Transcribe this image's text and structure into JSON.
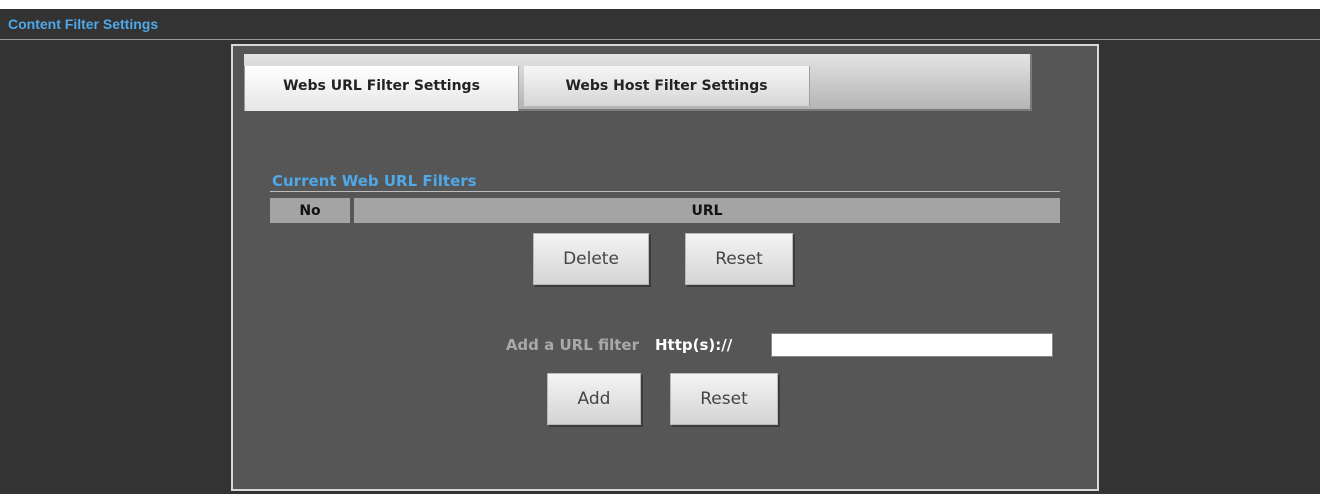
{
  "header": {
    "title": "Content Filter Settings"
  },
  "tabs": [
    {
      "label": "Webs URL Filter Settings",
      "active": true
    },
    {
      "label": "Webs Host Filter Settings",
      "active": false
    }
  ],
  "section": {
    "title": "Current Web URL Filters"
  },
  "table": {
    "columns": [
      "No",
      "URL"
    ],
    "rows": []
  },
  "list_actions": {
    "delete_label": "Delete",
    "reset_label": "Reset"
  },
  "add_form": {
    "label": "Add a URL filter",
    "prefix": "Http(s)://",
    "input_value": "",
    "add_label": "Add",
    "reset_label": "Reset"
  },
  "colors": {
    "accent": "#4fa8e8",
    "background": "#333333",
    "panel": "#565656"
  }
}
